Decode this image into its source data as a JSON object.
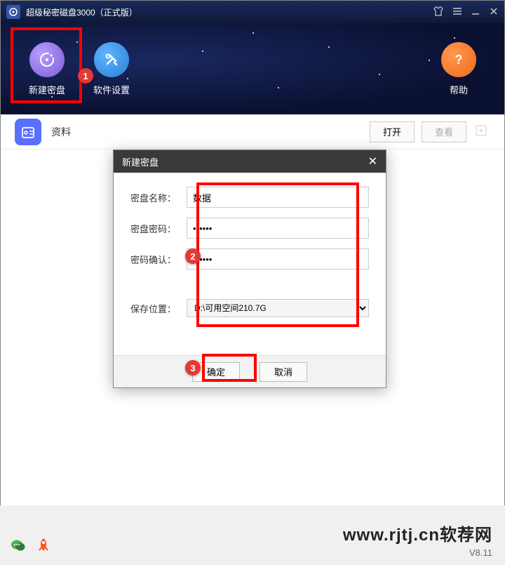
{
  "title": "超级秘密磁盘3000（正式版）",
  "toolbar": {
    "new_disk": "新建密盘",
    "settings": "软件设置",
    "help": "帮助"
  },
  "content": {
    "item_label": "资料",
    "open_btn": "打开",
    "view_btn": "查看"
  },
  "dialog": {
    "title": "新建密盘",
    "name_label": "密盘名称：",
    "name_value": "数据",
    "password_label": "密盘密码：",
    "password_value": "••••••",
    "confirm_label": "密码确认：",
    "confirm_value": "••••••",
    "location_label": "保存位置：",
    "location_value": "D:\\可用空间210.7G",
    "ok_btn": "确定",
    "cancel_btn": "取消"
  },
  "annotations": {
    "badge1": "1",
    "badge2": "2",
    "badge3": "3"
  },
  "watermark": "www.rjtj.cn软荐网",
  "version": "V8.11"
}
